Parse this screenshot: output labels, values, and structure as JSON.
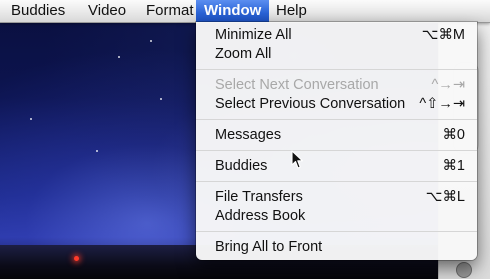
{
  "menubar": {
    "items": [
      "Buddies",
      "Video",
      "Format",
      "Window",
      "Help"
    ],
    "selected_index": 3
  },
  "window_menu": {
    "groups": [
      [
        {
          "label": "Minimize All",
          "shortcut": "⌥⌘M",
          "enabled": true
        },
        {
          "label": "Zoom All",
          "shortcut": "",
          "enabled": true
        }
      ],
      [
        {
          "label": "Select Next Conversation",
          "shortcut": "^→⇥",
          "enabled": false
        },
        {
          "label": "Select Previous Conversation",
          "shortcut": "^⇧→⇥",
          "enabled": true
        }
      ],
      [
        {
          "label": "Messages",
          "shortcut": "⌘0",
          "enabled": true
        }
      ],
      [
        {
          "label": "Buddies",
          "shortcut": "⌘1",
          "enabled": true
        }
      ],
      [
        {
          "label": "File Transfers",
          "shortcut": "⌥⌘L",
          "enabled": true
        },
        {
          "label": "Address Book",
          "shortcut": "",
          "enabled": true
        }
      ],
      [
        {
          "label": "Bring All to Front",
          "shortcut": "",
          "enabled": true
        }
      ]
    ]
  },
  "colors": {
    "selection_blue": "#2a63d6",
    "menu_bg": "#f8f8f8",
    "disabled_text": "#a8a8a8"
  },
  "icons": {
    "cursor": "arrow-pointer-icon"
  }
}
